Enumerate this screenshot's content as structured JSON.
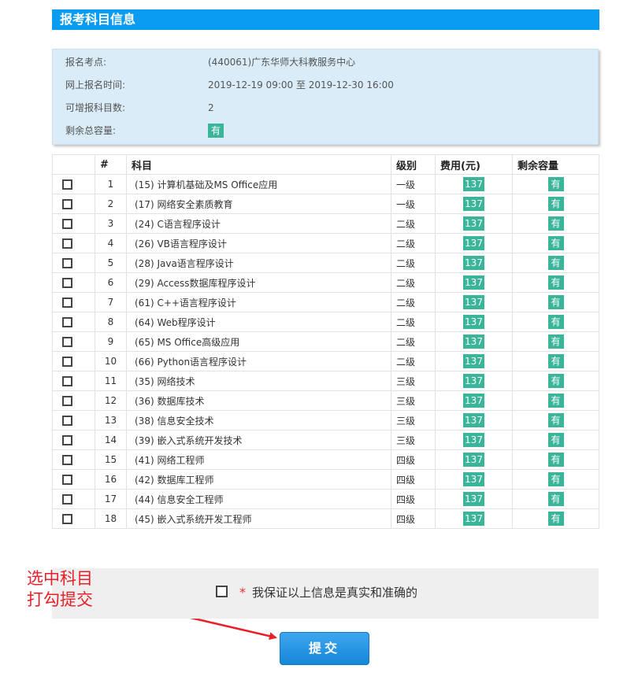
{
  "header": {
    "title": "报考科目信息"
  },
  "info": {
    "rows": [
      {
        "label": "报名考点:",
        "value": "(440061)广东华师大科教服务中心"
      },
      {
        "label": "网上报名时间:",
        "value": "2019-12-19 09:00 至 2019-12-30 16:00"
      },
      {
        "label": "可增报科目数:",
        "value": "2"
      },
      {
        "label": "剩余总容量:",
        "value": "有"
      }
    ]
  },
  "table": {
    "headers": [
      "",
      "#",
      "科目",
      "级别",
      "费用(元)",
      "剩余容量"
    ],
    "rows": [
      {
        "num": "1",
        "subject": "(15) 计算机基础及MS Office应用",
        "level": "一级",
        "fee": "137",
        "capacity": "有"
      },
      {
        "num": "2",
        "subject": "(17) 网络安全素质教育",
        "level": "一级",
        "fee": "137",
        "capacity": "有"
      },
      {
        "num": "3",
        "subject": "(24) C语言程序设计",
        "level": "二级",
        "fee": "137",
        "capacity": "有"
      },
      {
        "num": "4",
        "subject": "(26) VB语言程序设计",
        "level": "二级",
        "fee": "137",
        "capacity": "有"
      },
      {
        "num": "5",
        "subject": "(28) Java语言程序设计",
        "level": "二级",
        "fee": "137",
        "capacity": "有"
      },
      {
        "num": "6",
        "subject": "(29) Access数据库程序设计",
        "level": "二级",
        "fee": "137",
        "capacity": "有"
      },
      {
        "num": "7",
        "subject": "(61) C++语言程序设计",
        "level": "二级",
        "fee": "137",
        "capacity": "有"
      },
      {
        "num": "8",
        "subject": "(64) Web程序设计",
        "level": "二级",
        "fee": "137",
        "capacity": "有"
      },
      {
        "num": "9",
        "subject": "(65) MS Office高级应用",
        "level": "二级",
        "fee": "137",
        "capacity": "有"
      },
      {
        "num": "10",
        "subject": "(66) Python语言程序设计",
        "level": "二级",
        "fee": "137",
        "capacity": "有"
      },
      {
        "num": "11",
        "subject": "(35) 网络技术",
        "level": "三级",
        "fee": "137",
        "capacity": "有"
      },
      {
        "num": "12",
        "subject": "(36) 数据库技术",
        "level": "三级",
        "fee": "137",
        "capacity": "有"
      },
      {
        "num": "13",
        "subject": "(38) 信息安全技术",
        "level": "三级",
        "fee": "137",
        "capacity": "有"
      },
      {
        "num": "14",
        "subject": "(39) 嵌入式系统开发技术",
        "level": "三级",
        "fee": "137",
        "capacity": "有"
      },
      {
        "num": "15",
        "subject": "(41) 网络工程师",
        "level": "四级",
        "fee": "137",
        "capacity": "有"
      },
      {
        "num": "16",
        "subject": "(42) 数据库工程师",
        "level": "四级",
        "fee": "137",
        "capacity": "有"
      },
      {
        "num": "17",
        "subject": "(44) 信息安全工程师",
        "level": "四级",
        "fee": "137",
        "capacity": "有"
      },
      {
        "num": "18",
        "subject": "(45) 嵌入式系统开发工程师",
        "level": "四级",
        "fee": "137",
        "capacity": "有"
      }
    ]
  },
  "confirm": {
    "star": "*",
    "text": "我保证以上信息是真实和准确的"
  },
  "annotation": {
    "line1": "选中科目",
    "line2": "打勾提交"
  },
  "submit": {
    "label": "提交"
  },
  "colors": {
    "header": "#0a9cf0",
    "badge": "#3bb59a",
    "annotation": "#e8202a",
    "button": "#1686d8"
  }
}
